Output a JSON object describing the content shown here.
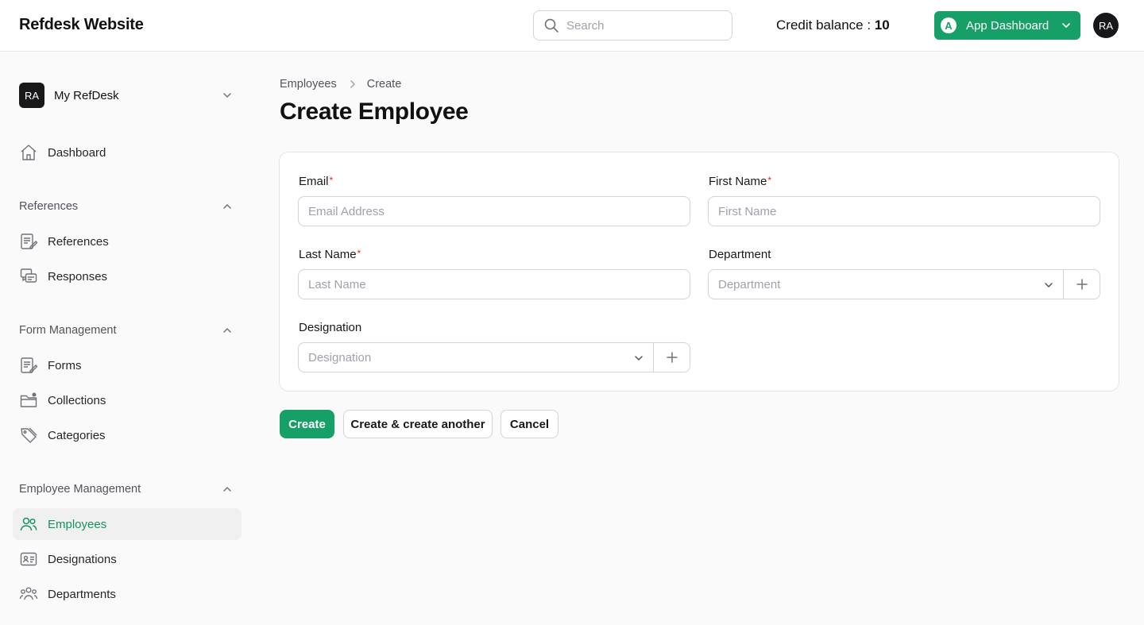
{
  "header": {
    "brand": "Refdesk Website",
    "search_placeholder": "Search",
    "credit_label": "Credit balance :",
    "credit_value": "10",
    "app_dashboard": {
      "badge": "A",
      "label": "App Dashboard"
    },
    "user_initials": "RA"
  },
  "sidebar": {
    "team": {
      "initials": "RA",
      "name": "My RefDesk"
    },
    "dashboard": "Dashboard",
    "groups": [
      {
        "label": "References",
        "items": [
          "References",
          "Responses"
        ]
      },
      {
        "label": "Form Management",
        "items": [
          "Forms",
          "Collections",
          "Categories"
        ]
      },
      {
        "label": "Employee Management",
        "items": [
          "Employees",
          "Designations",
          "Departments"
        ]
      }
    ],
    "active_item": "Employees"
  },
  "main": {
    "breadcrumb": [
      "Employees",
      "Create"
    ],
    "title": "Create Employee",
    "form": {
      "email": {
        "label": "Email",
        "required_mark": "*",
        "placeholder": "Email Address"
      },
      "first_name": {
        "label": "First Name",
        "required_mark": "*",
        "placeholder": "First Name"
      },
      "last_name": {
        "label": "Last Name",
        "required_mark": "*",
        "placeholder": "Last Name"
      },
      "department": {
        "label": "Department",
        "placeholder": "Department"
      },
      "designation": {
        "label": "Designation",
        "placeholder": "Designation"
      }
    },
    "actions": {
      "create": "Create",
      "create_another": "Create & create another",
      "cancel": "Cancel"
    }
  },
  "colors": {
    "accent": "#16a068",
    "active_text": "#15935f",
    "required": "#dc2626"
  },
  "icons": [
    "search-icon",
    "chevron-down-icon",
    "chevron-up-icon",
    "chevron-right-icon",
    "home-icon",
    "references-icon",
    "responses-icon",
    "forms-icon",
    "collections-icon",
    "categories-icon",
    "employees-icon",
    "designations-icon",
    "departments-icon",
    "plus-icon"
  ]
}
